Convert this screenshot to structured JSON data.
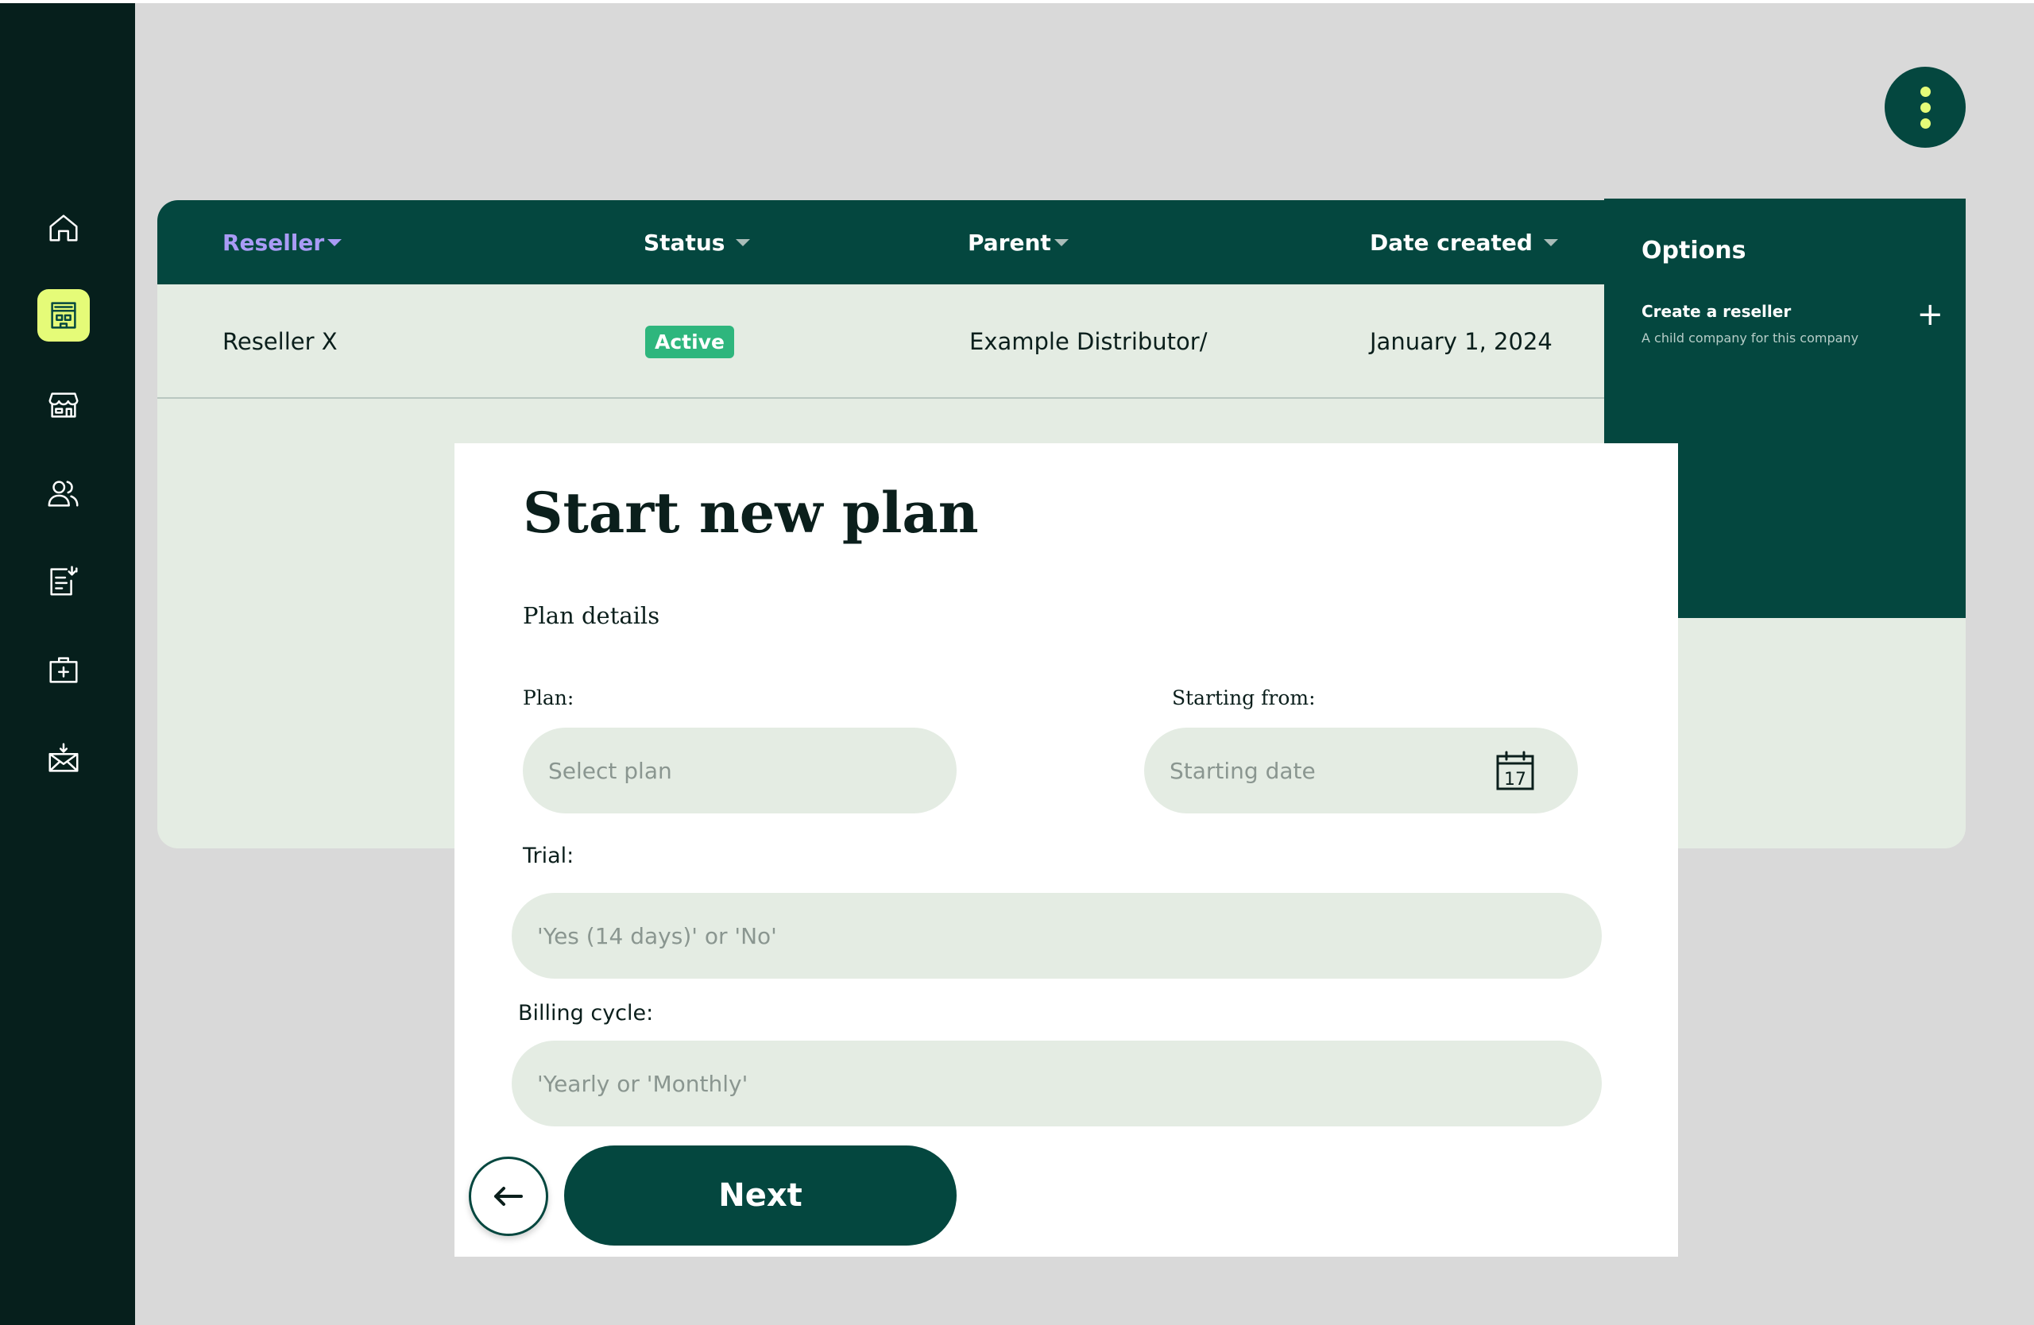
{
  "sidebar": {
    "items": [
      {
        "icon": "home-icon"
      },
      {
        "icon": "building-icon",
        "active": true
      },
      {
        "icon": "store-icon"
      },
      {
        "icon": "users-icon"
      },
      {
        "icon": "document-icon"
      },
      {
        "icon": "medical-kit-icon"
      },
      {
        "icon": "mail-icon"
      }
    ]
  },
  "table": {
    "columns": [
      {
        "label": "Reseller",
        "sorted": true
      },
      {
        "label": "Status"
      },
      {
        "label": "Parent"
      },
      {
        "label": "Date created"
      }
    ],
    "rows": [
      {
        "reseller": "Reseller X",
        "status": "Active",
        "parent": "Example Distributor/",
        "date": "January 1, 2024"
      }
    ]
  },
  "options": {
    "title": "Options",
    "items": [
      {
        "label": "Create a reseller",
        "description": "A child company for this company",
        "icon": "plus-icon"
      }
    ]
  },
  "modal": {
    "title": "Start new plan",
    "section": "Plan details",
    "plan": {
      "label": "Plan:",
      "placeholder": "Select plan"
    },
    "start": {
      "label": "Starting from:",
      "placeholder": "Starting date",
      "calendar_day": "17"
    },
    "trial": {
      "label": "Trial:",
      "placeholder": "'Yes (14 days)' or 'No'"
    },
    "billing": {
      "label": "Billing cycle:",
      "placeholder": "'Yearly or 'Monthly'"
    },
    "next_label": "Next"
  },
  "colors": {
    "sidebar": "#061f1c",
    "primary": "#04473f",
    "accent": "#e5fb78",
    "sorted_header": "#a99bf5",
    "status_active": "#2eb67d",
    "field_bg": "#e4ece3"
  }
}
